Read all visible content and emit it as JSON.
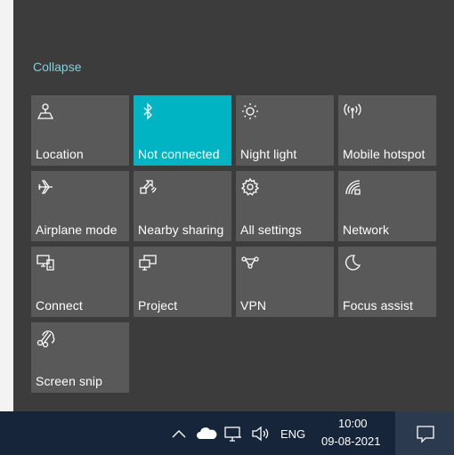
{
  "action_center": {
    "collapse_label": "Collapse",
    "accent_color": "#00b4c4",
    "tiles": [
      {
        "label": "Location",
        "icon": "location-icon",
        "active": false
      },
      {
        "label": "Not connected",
        "icon": "bluetooth-icon",
        "active": true
      },
      {
        "label": "Night light",
        "icon": "night-light-icon",
        "active": false
      },
      {
        "label": "Mobile hotspot",
        "icon": "mobile-hotspot-icon",
        "active": false
      },
      {
        "label": "Airplane mode",
        "icon": "airplane-icon",
        "active": false
      },
      {
        "label": "Nearby sharing",
        "icon": "nearby-sharing-icon",
        "active": false
      },
      {
        "label": "All settings",
        "icon": "gear-icon",
        "active": false
      },
      {
        "label": "Network",
        "icon": "network-icon",
        "active": false
      },
      {
        "label": "Connect",
        "icon": "connect-icon",
        "active": false
      },
      {
        "label": "Project",
        "icon": "project-icon",
        "active": false
      },
      {
        "label": "VPN",
        "icon": "vpn-icon",
        "active": false
      },
      {
        "label": "Focus assist",
        "icon": "moon-icon",
        "active": false
      },
      {
        "label": "Screen snip",
        "icon": "screen-snip-icon",
        "active": false
      }
    ]
  },
  "taskbar": {
    "language": "ENG",
    "time": "10:00",
    "date": "09-08-2021",
    "tray_icons": [
      "chevron-up-icon",
      "onedrive-cloud-icon",
      "network-monitor-icon",
      "volume-icon"
    ],
    "notification_icon": "notification-icon"
  }
}
